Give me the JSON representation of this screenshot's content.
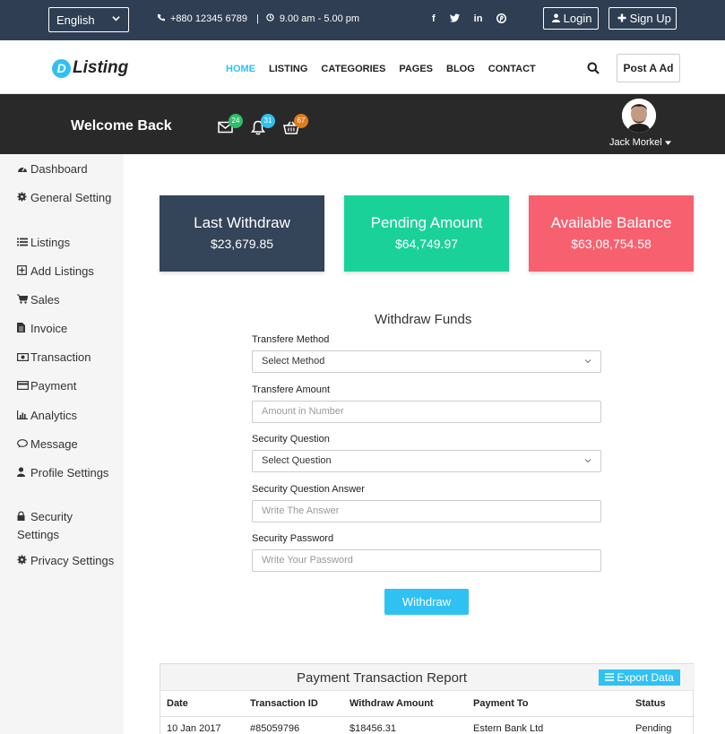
{
  "topbar": {
    "language": "English",
    "phone": "+880 12345 6789",
    "separator": "|",
    "hours": "9.00 am - 5.00 pm",
    "social": [
      "f",
      "t",
      "in",
      "p"
    ],
    "login_label": "Login",
    "signup_label": "Sign Up"
  },
  "nav": {
    "logo_mark": "D",
    "logo_text": "Listing",
    "items": [
      "HOME",
      "LISTING",
      "CATEGORIES",
      "PAGES",
      "BLOG",
      "CONTACT"
    ],
    "post_label": "Post A Ad"
  },
  "welcome": {
    "title": "Welcome Back",
    "mail_count": "24",
    "notif_count": "31",
    "cart_count": "67",
    "user_name": "Jack Morkel"
  },
  "sidebar": {
    "items": [
      {
        "label": "Dashboard",
        "icon": "dashboard-icon"
      },
      {
        "label": "General Setting",
        "icon": "gear-icon"
      },
      {
        "label": "Listings",
        "icon": "list-icon"
      },
      {
        "label": "Add Listings",
        "icon": "plus-square-icon"
      },
      {
        "label": "Sales",
        "icon": "cart-icon"
      },
      {
        "label": "Invoice",
        "icon": "file-icon"
      },
      {
        "label": "Transaction",
        "icon": "money-icon"
      },
      {
        "label": "Payment",
        "icon": "credit-card-icon"
      },
      {
        "label": "Analytics",
        "icon": "bar-chart-icon"
      },
      {
        "label": "Message",
        "icon": "comment-icon"
      },
      {
        "label": "Profile Settings",
        "icon": "user-icon"
      },
      {
        "label": "Security Settings",
        "icon": "lock-icon"
      },
      {
        "label": "Privacy Settings",
        "icon": "gear-icon"
      }
    ]
  },
  "cards": [
    {
      "title": "Last Withdraw",
      "value": "$23,679.85",
      "color": "#344459"
    },
    {
      "title": "Pending Amount",
      "value": "$64,749.97",
      "color": "#1bd19a"
    },
    {
      "title": "Available Balance",
      "value": "$63,08,754.58",
      "color": "#f7606e"
    }
  ],
  "form": {
    "title": "Withdraw Funds",
    "method_label": "Transfere Method",
    "method_value": "Select Method",
    "amount_label": "Transfere Amount",
    "amount_placeholder": "Amount in Number",
    "question_label": "Security Question",
    "question_value": "Select Question",
    "answer_label": "Security Question Answer",
    "answer_placeholder": "Write The Answer",
    "password_label": "Security Password",
    "password_placeholder": "Write Your Password",
    "submit_label": "Withdraw"
  },
  "report": {
    "title": "Payment Transaction Report",
    "export_label": "Export Data",
    "columns": [
      "Date",
      "Transaction ID",
      "Withdraw Amount",
      "Payment To",
      "Status"
    ],
    "rows": [
      [
        "10 Jan 2017",
        "#85059796",
        "$18456.31",
        "Estern Bank Ltd",
        "Pending"
      ]
    ]
  }
}
